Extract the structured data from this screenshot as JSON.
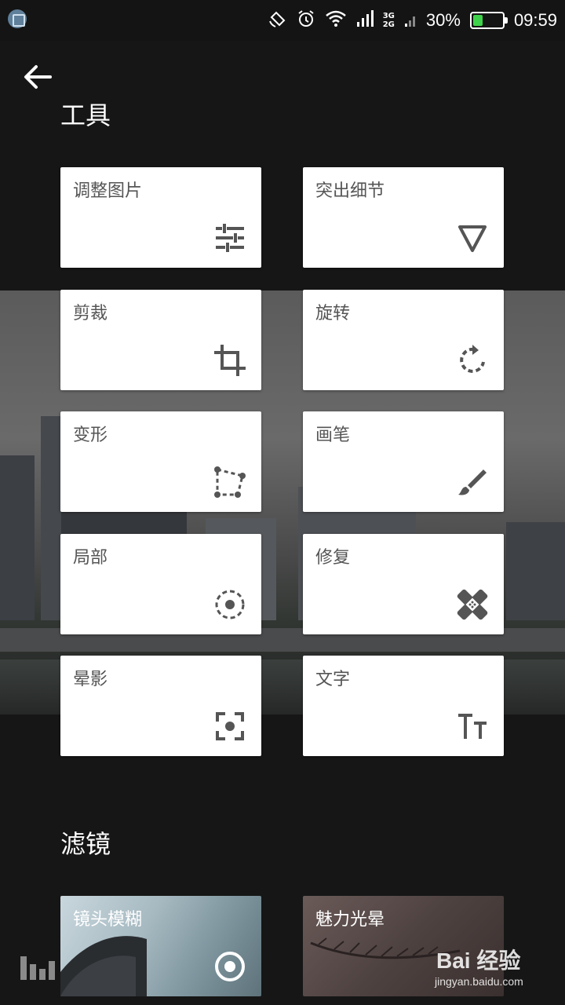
{
  "status_bar": {
    "network": [
      "3G",
      "2G"
    ],
    "battery_percent": "30%",
    "battery_level": 0.3,
    "time": "09:59",
    "battery_color": "#3ed24a"
  },
  "header": {
    "back_icon": "arrow-left-icon"
  },
  "tools_section": {
    "title": "工具",
    "items": [
      {
        "label": "调整图片",
        "icon": "sliders-icon"
      },
      {
        "label": "突出细节",
        "icon": "triangle-down-icon"
      },
      {
        "label": "剪裁",
        "icon": "crop-icon"
      },
      {
        "label": "旋转",
        "icon": "rotate-icon"
      },
      {
        "label": "变形",
        "icon": "perspective-icon"
      },
      {
        "label": "画笔",
        "icon": "brush-icon"
      },
      {
        "label": "局部",
        "icon": "selective-icon"
      },
      {
        "label": "修复",
        "icon": "healing-icon"
      },
      {
        "label": "晕影",
        "icon": "vignette-icon"
      },
      {
        "label": "文字",
        "icon": "text-icon"
      }
    ]
  },
  "filters_section": {
    "title": "滤镜",
    "items": [
      {
        "label": "镜头模糊",
        "icon": "target-icon"
      },
      {
        "label": "魅力光晕",
        "icon": "none"
      }
    ]
  },
  "watermark": {
    "brand": "Bai 经验",
    "url": "jingyan.baidu.com"
  }
}
